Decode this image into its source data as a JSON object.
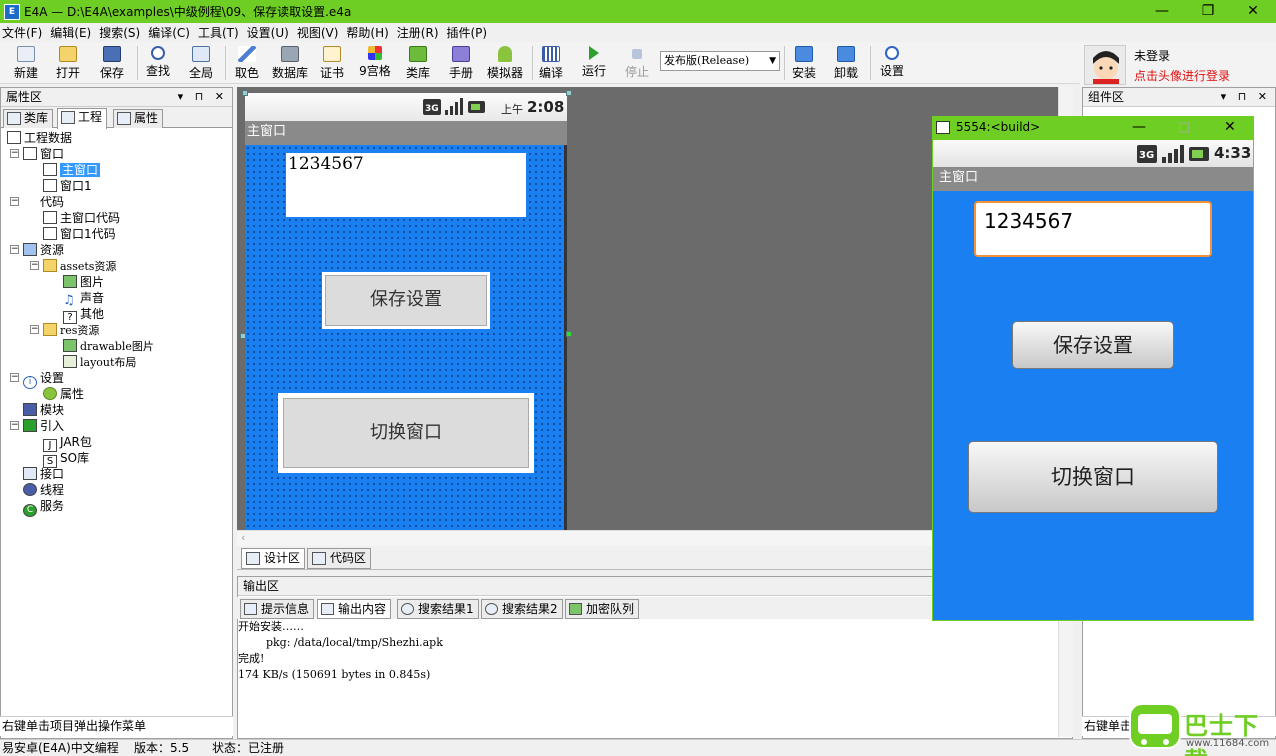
{
  "window": {
    "title": "E4A — D:\\E4A\\examples\\中级例程\\09、保存读取设置.e4a",
    "minimize": "—",
    "maximize": "❐",
    "close": "✕"
  },
  "menu": [
    "文件(F)",
    "编辑(E)",
    "搜索(S)",
    "编译(C)",
    "工具(T)",
    "设置(U)",
    "视图(V)",
    "帮助(H)",
    "注册(R)",
    "插件(P)"
  ],
  "toolbar": {
    "new": "新建",
    "open": "打开",
    "save": "保存",
    "find": "查找",
    "global": "全局",
    "color": "取色",
    "database": "数据库",
    "cert": "证书",
    "grid9": "9宫格",
    "library": "类库",
    "manual": "手册",
    "emulator": "模拟器",
    "compile": "编译",
    "run": "运行",
    "stop": "停止",
    "release": "发布版(Release)",
    "install": "安装",
    "uninstall": "卸载",
    "settings": "设置"
  },
  "user": {
    "status": "未登录",
    "hint": "点击头像进行登录"
  },
  "left_panel": {
    "title": "属性区",
    "tabs": [
      "类库",
      "工程",
      "属性"
    ],
    "tree": [
      "工程数据",
      "窗口",
      "主窗口",
      "窗口1",
      "代码",
      "主窗口代码",
      "窗口1代码",
      "资源",
      "assets资源",
      "图片",
      "声音",
      "其他",
      "res资源",
      "drawable图片",
      "layout布局",
      "设置",
      "属性",
      "模块",
      "引入",
      "JAR包",
      "SO库",
      "接口",
      "线程",
      "服务"
    ],
    "hint": "右键单击项目弹出操作菜单"
  },
  "designer": {
    "clock_prefix": "上午",
    "clock": "2:08",
    "title": "主窗口",
    "input": "1234567",
    "save_button": "保存设置",
    "switch_button": "切换窗口",
    "tabs": [
      "设计区",
      "代码区"
    ]
  },
  "output": {
    "title": "输出区",
    "tabs": [
      "提示信息",
      "输出内容",
      "搜索结果1",
      "搜索结果2",
      "加密队列"
    ],
    "lines": [
      "开始安装……",
      "        pkg: /data/local/tmp/Shezhi.apk",
      "完成!",
      "174 KB/s (150691 bytes in 0.845s)"
    ]
  },
  "right_panel": {
    "title": "组件区",
    "hint": "右键单击"
  },
  "emulator": {
    "title": "5554:<build>",
    "clock": "4:33",
    "app_title": "主窗口",
    "input": "1234567",
    "save_button": "保存设置",
    "switch_button": "切换窗口"
  },
  "status_bar": {
    "app": "易安卓(E4A)中文编程",
    "version": "版本：5.5",
    "state": "状态：已注册"
  },
  "watermark": {
    "text": "巴士下载",
    "url": "www.11684.com"
  }
}
